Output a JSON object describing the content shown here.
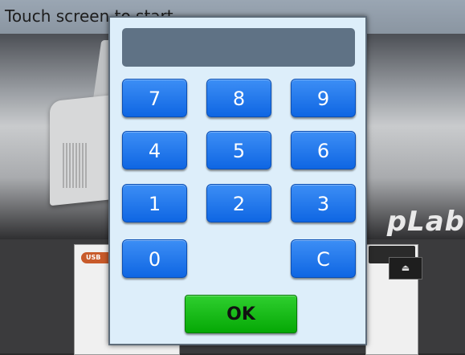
{
  "background": {
    "title": "Touch screen to start",
    "brand_text": "p̲Lab",
    "usb_badge": "USB"
  },
  "keypad": {
    "display_value": "",
    "keys": [
      "7",
      "8",
      "9",
      "4",
      "5",
      "6",
      "1",
      "2",
      "3",
      "0",
      "C"
    ],
    "ok_label": "OK"
  },
  "colors": {
    "key_blue": "#1a73ea",
    "ok_green": "#0ab80a",
    "dialog_bg": "#ddeefa",
    "display_bg": "#5f7285"
  }
}
